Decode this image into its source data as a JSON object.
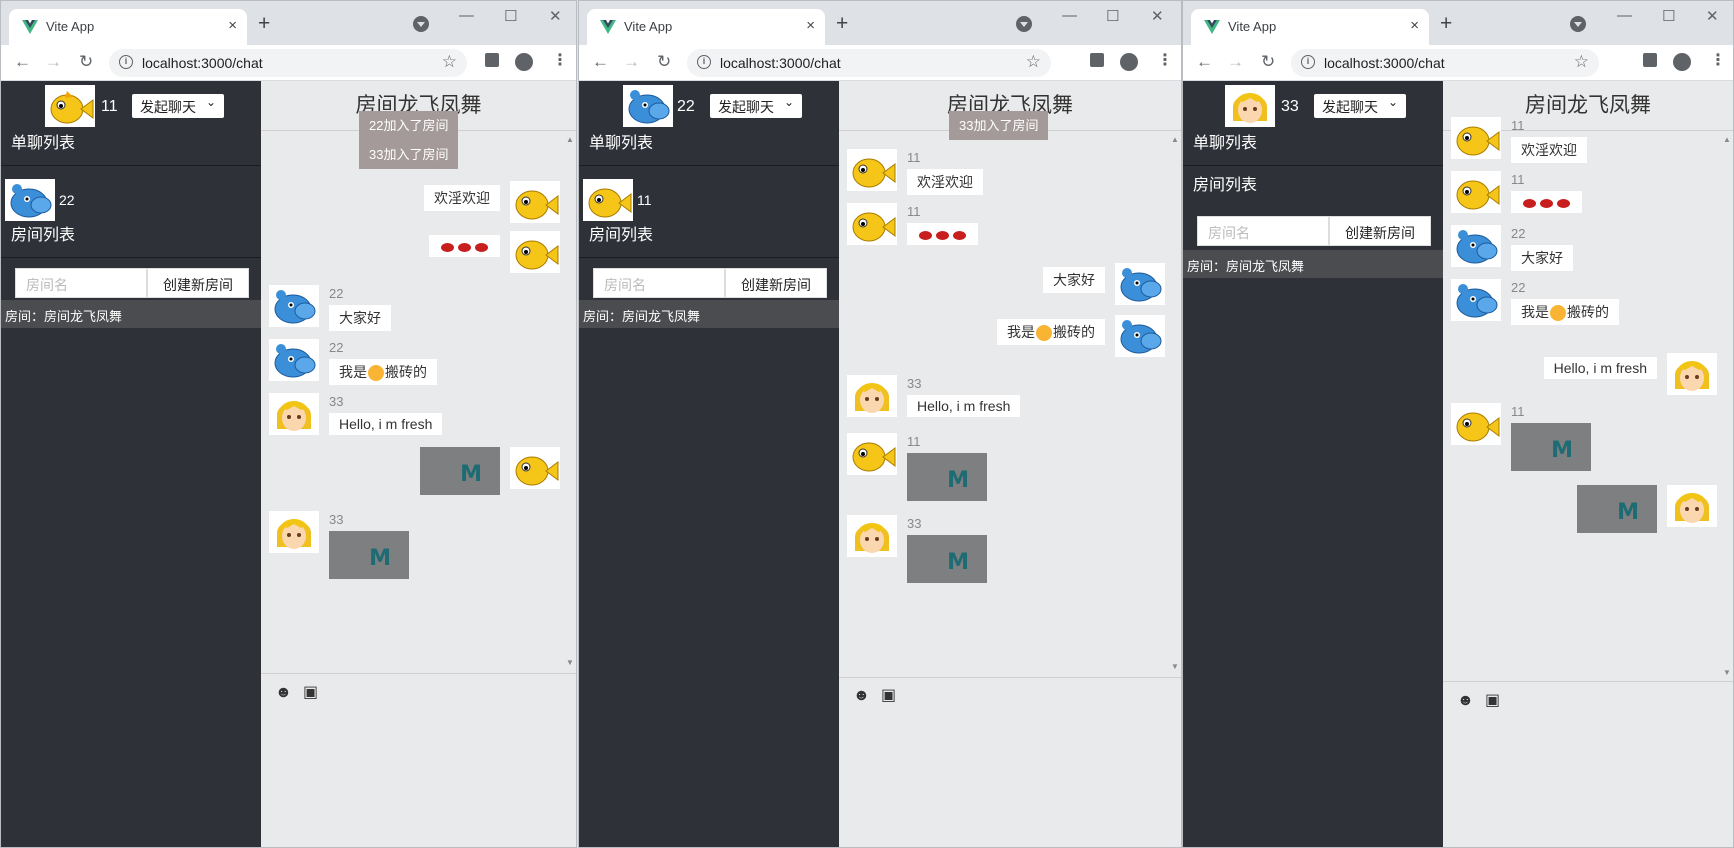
{
  "browser": {
    "tab_title": "Vite App",
    "url": "localhost:3000/chat",
    "tab_close": "×",
    "new_tab": "+"
  },
  "app": {
    "select_label": "发起聊天",
    "single_list_title": "单聊列表",
    "room_list_title": "房间列表",
    "room_input_placeholder": "房间名",
    "create_room_button": "创建新房间",
    "room_item": "房间：房间龙飞凤舞",
    "room_title": "房间龙飞凤舞"
  },
  "windows": [
    {
      "me": "11",
      "single_users": [
        "22"
      ],
      "system_messages": [
        "22加入了房间",
        "33加入了房间"
      ],
      "messages": [
        {
          "side": "right",
          "text": "欢淫欢迎"
        },
        {
          "side": "right",
          "emoji": "lips×3"
        },
        {
          "side": "left",
          "name": "22",
          "text": "大家好"
        },
        {
          "side": "left",
          "name": "22",
          "text": "我是",
          "suffix": "搬砖的"
        },
        {
          "side": "left",
          "name": "33",
          "text": "Hello, i m fresh"
        },
        {
          "side": "right",
          "image": "M"
        },
        {
          "side": "left",
          "name": "33",
          "image": "M"
        }
      ]
    },
    {
      "me": "22",
      "single_users": [
        "11"
      ],
      "system_messages": [
        "33加入了房间"
      ],
      "messages": [
        {
          "side": "left",
          "name": "11",
          "text": "欢淫欢迎"
        },
        {
          "side": "left",
          "name": "11",
          "emoji": "lips×3"
        },
        {
          "side": "right",
          "text": "大家好"
        },
        {
          "side": "right",
          "text": "我是",
          "suffix": "搬砖的"
        },
        {
          "side": "left",
          "name": "33",
          "text": "Hello, i m fresh"
        },
        {
          "side": "left",
          "name": "11",
          "image": "M"
        },
        {
          "side": "left",
          "name": "33",
          "image": "M"
        }
      ]
    },
    {
      "me": "33",
      "single_users": [],
      "system_messages": [],
      "messages": [
        {
          "side": "left",
          "name": "11",
          "text": "欢淫欢迎"
        },
        {
          "side": "left",
          "name": "11",
          "emoji": "lips×3"
        },
        {
          "side": "left",
          "name": "22",
          "text": "大家好"
        },
        {
          "side": "left",
          "name": "22",
          "text": "我是",
          "suffix": "搬砖的"
        },
        {
          "side": "right",
          "text": "Hello, i m fresh"
        },
        {
          "side": "left",
          "name": "11",
          "image": "M"
        },
        {
          "side": "right",
          "image": "M"
        }
      ]
    }
  ],
  "colors": {
    "sidebar_bg": "#2e3238",
    "main_bg": "#e9eaeb",
    "system_msg_bg": "#a49a9a",
    "image_placeholder_bg": "#7d7f80",
    "vite_green": "#41b883"
  }
}
